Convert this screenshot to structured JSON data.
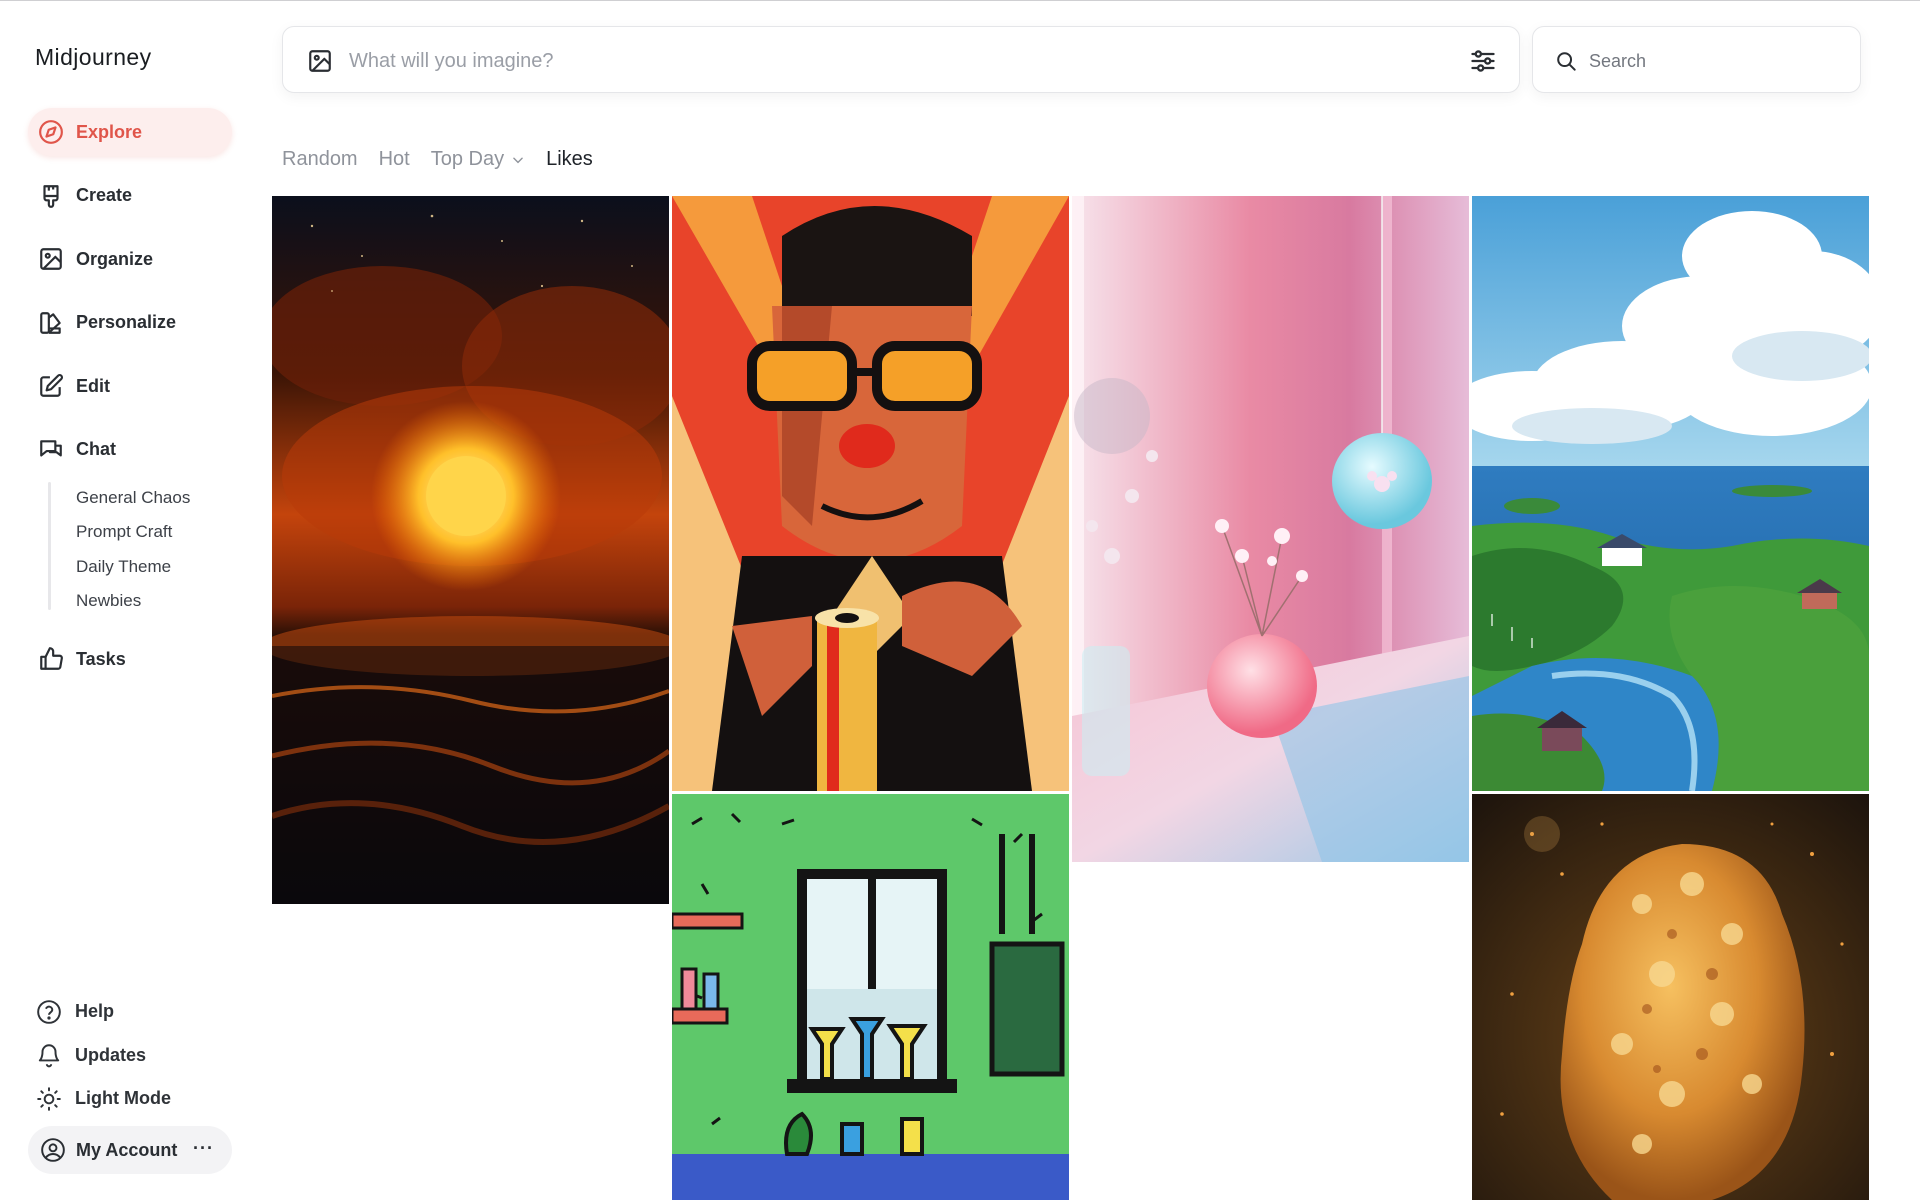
{
  "app": {
    "title": "Midjourney"
  },
  "sidebar": {
    "items": [
      {
        "label": "Explore",
        "icon": "compass-icon",
        "active": true
      },
      {
        "label": "Create",
        "icon": "brush-icon"
      },
      {
        "label": "Organize",
        "icon": "image-icon"
      },
      {
        "label": "Personalize",
        "icon": "palette-icon"
      },
      {
        "label": "Edit",
        "icon": "edit-icon"
      },
      {
        "label": "Chat",
        "icon": "chat-icon"
      },
      {
        "label": "Tasks",
        "icon": "thumbs-up-icon"
      }
    ],
    "chat_rooms": [
      "General Chaos",
      "Prompt Craft",
      "Daily Theme",
      "Newbies"
    ],
    "bottom": [
      {
        "label": "Help",
        "icon": "help-icon"
      },
      {
        "label": "Updates",
        "icon": "bell-icon"
      },
      {
        "label": "Light Mode",
        "icon": "sun-icon"
      }
    ],
    "account": {
      "label": "My Account",
      "more": "···"
    }
  },
  "prompt": {
    "placeholder": "What will you imagine?"
  },
  "search": {
    "placeholder": "Search"
  },
  "tabs": [
    {
      "label": "Random"
    },
    {
      "label": "Hot"
    },
    {
      "label": "Top Day",
      "has_dropdown": true
    },
    {
      "label": "Likes",
      "active": true
    }
  ],
  "colors": {
    "accent": "#e0554a",
    "accent_bg": "#fdeeed"
  }
}
